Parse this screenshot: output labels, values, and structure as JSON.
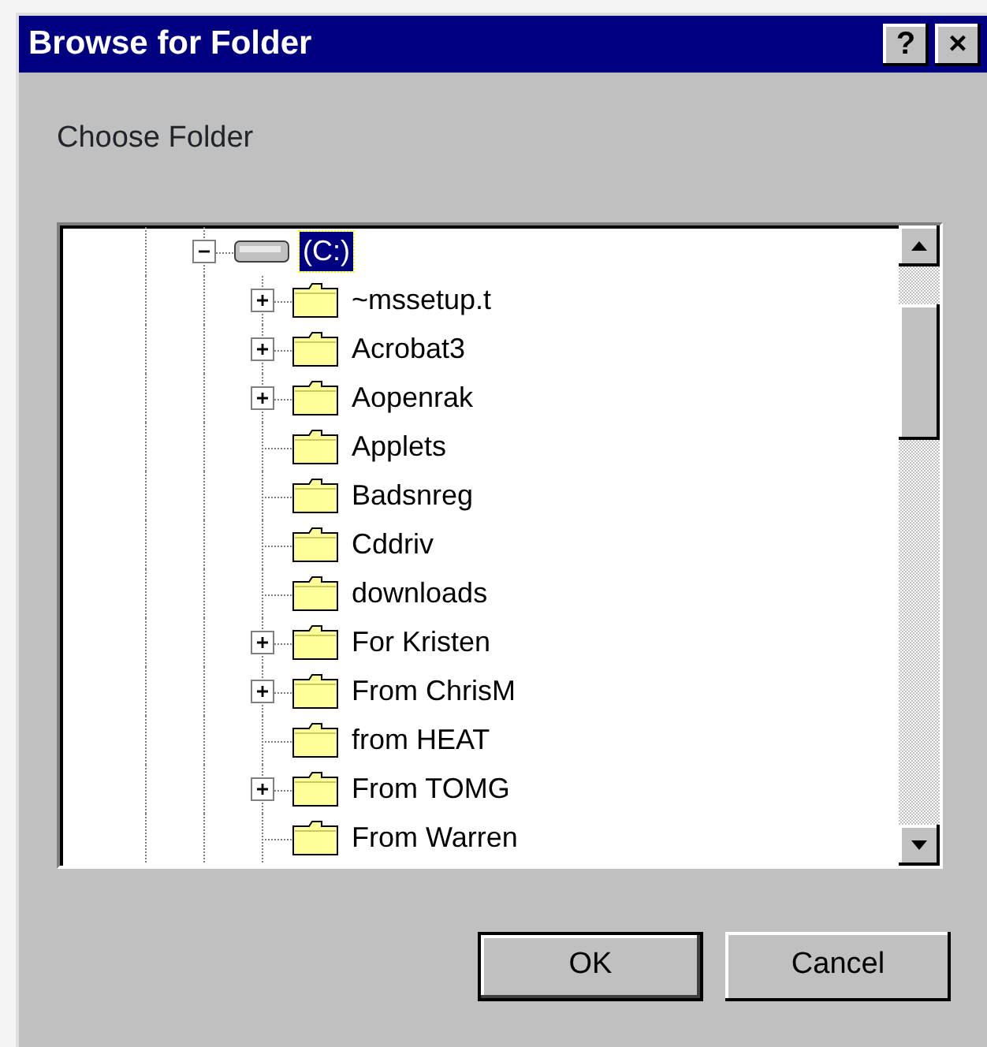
{
  "window": {
    "title": "Browse for Folder",
    "title_buttons": [
      "?",
      "×"
    ]
  },
  "instruction": "Choose Folder",
  "tree": {
    "items": [
      {
        "label": "(C:)",
        "kind": "drive",
        "expanded": true,
        "selected": true,
        "children": [
          {
            "label": "~mssetup.t",
            "kind": "folder",
            "expandable": true,
            "selected": false
          },
          {
            "label": "Acrobat3",
            "kind": "folder",
            "expandable": true,
            "selected": false
          },
          {
            "label": "Aopenrak",
            "kind": "folder",
            "expandable": true,
            "selected": false
          },
          {
            "label": "Applets",
            "kind": "folder",
            "expandable": false,
            "selected": false
          },
          {
            "label": "Badsnreg",
            "kind": "folder",
            "expandable": false,
            "selected": false
          },
          {
            "label": "Cddriv",
            "kind": "folder",
            "expandable": false,
            "selected": false
          },
          {
            "label": "downloads",
            "kind": "folder",
            "expandable": false,
            "selected": false
          },
          {
            "label": "For Kristen",
            "kind": "folder",
            "expandable": true,
            "selected": false
          },
          {
            "label": "From ChrisM",
            "kind": "folder",
            "expandable": true,
            "selected": false
          },
          {
            "label": "from HEAT",
            "kind": "folder",
            "expandable": false,
            "selected": false
          },
          {
            "label": "From TOMG",
            "kind": "folder",
            "expandable": true,
            "selected": false
          },
          {
            "label": "From Warren",
            "kind": "folder",
            "expandable": false,
            "selected": false
          }
        ]
      }
    ]
  },
  "buttons": [
    {
      "label": "OK",
      "default": true
    },
    {
      "label": "Cancel",
      "default": false
    }
  ]
}
